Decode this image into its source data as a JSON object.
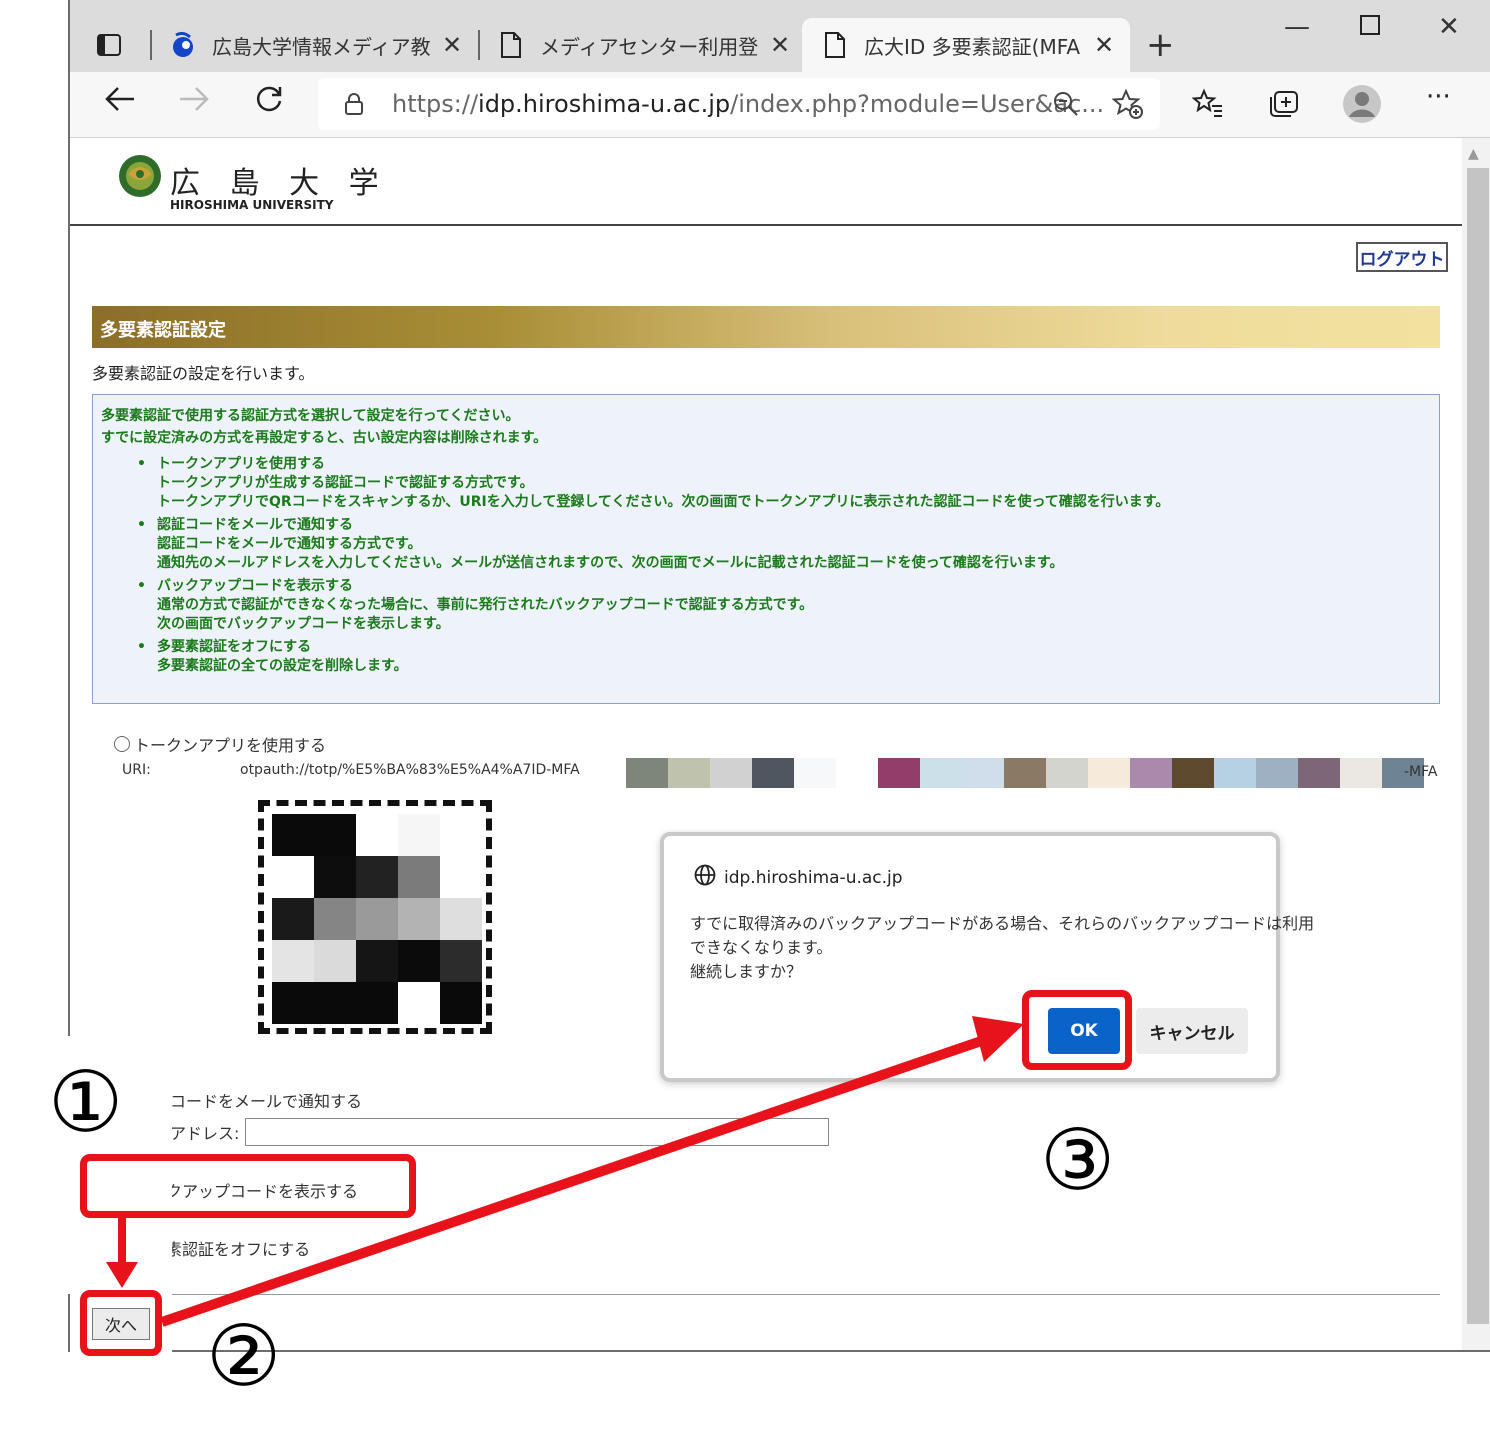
{
  "browser": {
    "tabs": [
      {
        "title": "広島大学情報メディア教育",
        "icon": "hiroshima-u-favicon",
        "active": false
      },
      {
        "title": "メディアセンター利用登録シ",
        "icon": "document-icon",
        "active": false
      },
      {
        "title": "広大ID 多要素認証(MFA",
        "icon": "document-icon",
        "active": true
      }
    ],
    "url_prefix": "https://",
    "url_host": "idp.hiroshima-u.ac.jp",
    "url_path": "/index.php?module=User&ac..."
  },
  "page": {
    "logo_jp": "広 島 大 学",
    "logo_en": "HIROSHIMA UNIVERSITY",
    "logout": "ログアウト",
    "section_title": "多要素認証設定",
    "intro": "多要素認証の設定を行います。",
    "info_line1": "多要素認証で使用する認証方式を選択して設定を行ってください。",
    "info_line2": "すでに設定済みの方式を再設定すると、古い設定内容は削除されます。",
    "methods": [
      {
        "title": "トークンアプリを使用する",
        "desc1": "トークンアプリが生成する認証コードで認証する方式です。",
        "desc2": "トークンアプリでQRコードをスキャンするか、URIを入力して登録してください。次の画面でトークンアプリに表示された認証コードを使って確認を行います。"
      },
      {
        "title": "認証コードをメールで通知する",
        "desc1": "認証コードをメールで通知する方式です。",
        "desc2": "通知先のメールアドレスを入力してください。メールが送信されますので、次の画面でメールに記載された認証コードを使って確認を行います。"
      },
      {
        "title": "バックアップコードを表示する",
        "desc1": "通常の方式で認証ができなくなった場合に、事前に発行されたバックアップコードで認証する方式です。",
        "desc2": "次の画面でバックアップコードを表示します。"
      },
      {
        "title": "多要素認証をオフにする",
        "desc1": "多要素認証の全ての設定を削除します。",
        "desc2": ""
      }
    ],
    "radio_token": "トークンアプリを使用する",
    "uri_label": "URI:",
    "uri_value": "otpauth://totp/%E5%BA%83%E5%A4%A7ID-MFA",
    "uri_suffix": "-MFA",
    "mail_option": "コードをメールで通知する",
    "address_label": "アドレス:",
    "radio_backup": "バックアップコードを表示する",
    "radio_off": "多要素認証をオフにする",
    "next_button": "次へ"
  },
  "dialog": {
    "host": "idp.hiroshima-u.ac.jp",
    "message_line1": "すでに取得済みのバックアップコードがある場合、それらのバックアップコードは利用",
    "message_line2": "できなくなります。",
    "message_line3": "継続しますか？",
    "ok": "OK",
    "cancel": "キャンセル"
  },
  "annotations": {
    "step1": "①",
    "step2": "②",
    "step3": "③",
    "color": "#e8131a"
  },
  "colors": {
    "uri_blocks": [
      "#7d8678",
      "#bfc2ad",
      "#d1d1d1",
      "#4f565f",
      "#f7f8fa",
      "#ffffff",
      "#923d6a",
      "#cce0ea",
      "#cfdeea",
      "#8a7a65",
      "#d4d4ce",
      "#f6eadb",
      "#a98aad",
      "#5e4a2e",
      "#b5d1e2",
      "#9eb1c3",
      "#7d6676",
      "#ebe7e2",
      "#6e8494"
    ],
    "qr_cells": [
      "#0a0a0a",
      "#0a0a0a",
      "#ffffff",
      "#f6f6f6",
      "#ffffff",
      "#ffffff",
      "#0d0d0d",
      "#222222",
      "#7b7b7b",
      "#ffffff",
      "#1a1a1a",
      "#858585",
      "#9a9a9a",
      "#b3b3b3",
      "#dedede",
      "#e4e4e4",
      "#dadada",
      "#151515",
      "#0b0b0b",
      "#2c2c2c",
      "#0a0a0a",
      "#0a0a0a",
      "#0a0a0a",
      "#ffffff",
      "#0a0a0a"
    ]
  }
}
